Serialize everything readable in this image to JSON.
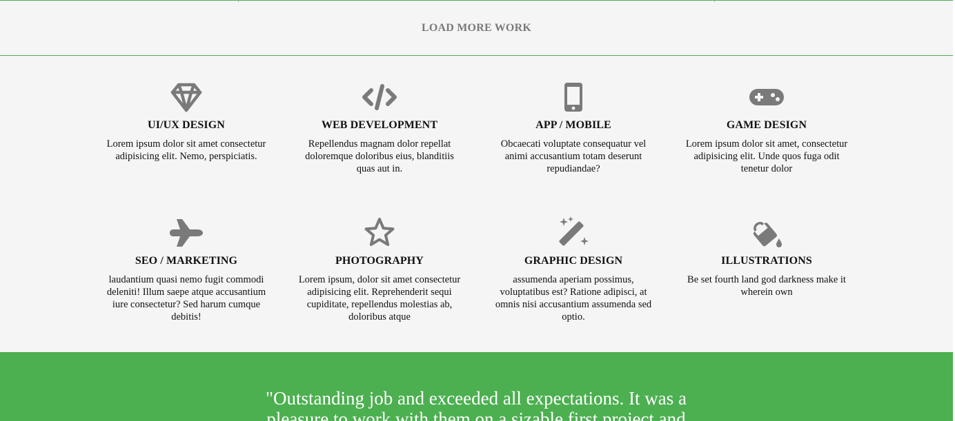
{
  "load_more": {
    "label": "LOAD MORE WORK"
  },
  "services": [
    {
      "icon": "diamond-icon",
      "title": "UI/UX DESIGN",
      "text": "Lorem ipsum dolor sit amet consectetur adipisicing elit. Nemo, perspiciatis."
    },
    {
      "icon": "code-icon",
      "title": "WEB DEVELOPMENT",
      "text": "Repellendus magnam dolor repellat doloremque doloribus eius, blanditiis quas aut in."
    },
    {
      "icon": "mobile-phone-icon",
      "title": "APP / MOBILE",
      "text": "Obcaecati voluptate consequatur vel animi accusantium totam deserunt repudiandae?"
    },
    {
      "icon": "gamepad-icon",
      "title": "GAME DESIGN",
      "text": "Lorem ipsum dolor sit amet, consectetur adipisicing elit. Unde quos fuga odit tenetur dolor"
    },
    {
      "icon": "airplane-icon",
      "title": "SEO / MARKETING",
      "text": "laudantium quasi nemo fugit commodi deleniti! Illum saepe atque accusantium iure consectetur? Sed harum cumque debitis!"
    },
    {
      "icon": "star-icon",
      "title": "PHOTOGRAPHY",
      "text": "Lorem ipsum, dolor sit amet consectetur adipisicing elit. Reprehenderit sequi cupiditate, repellendus molestias ab, doloribus atque"
    },
    {
      "icon": "magic-wand-icon",
      "title": "GRAPHIC DESIGN",
      "text": "assumenda aperiam possimus, voluptatibus est? Ratione adipisci, at omnis nisi accusantium assumenda sed optio."
    },
    {
      "icon": "paint-bucket-icon",
      "title": "ILLUSTRATIONS",
      "text": "Be set fourth land god darkness make it wherein own"
    }
  ],
  "testimonial": {
    "quote": "\"Outstanding job and exceeded all expectations. It was a pleasure to work with them on a sizable first project and"
  },
  "colors": {
    "accent": "#4caf50",
    "icon": "#7a7a7a",
    "background": "#f5f5f5",
    "text": "#111111"
  }
}
